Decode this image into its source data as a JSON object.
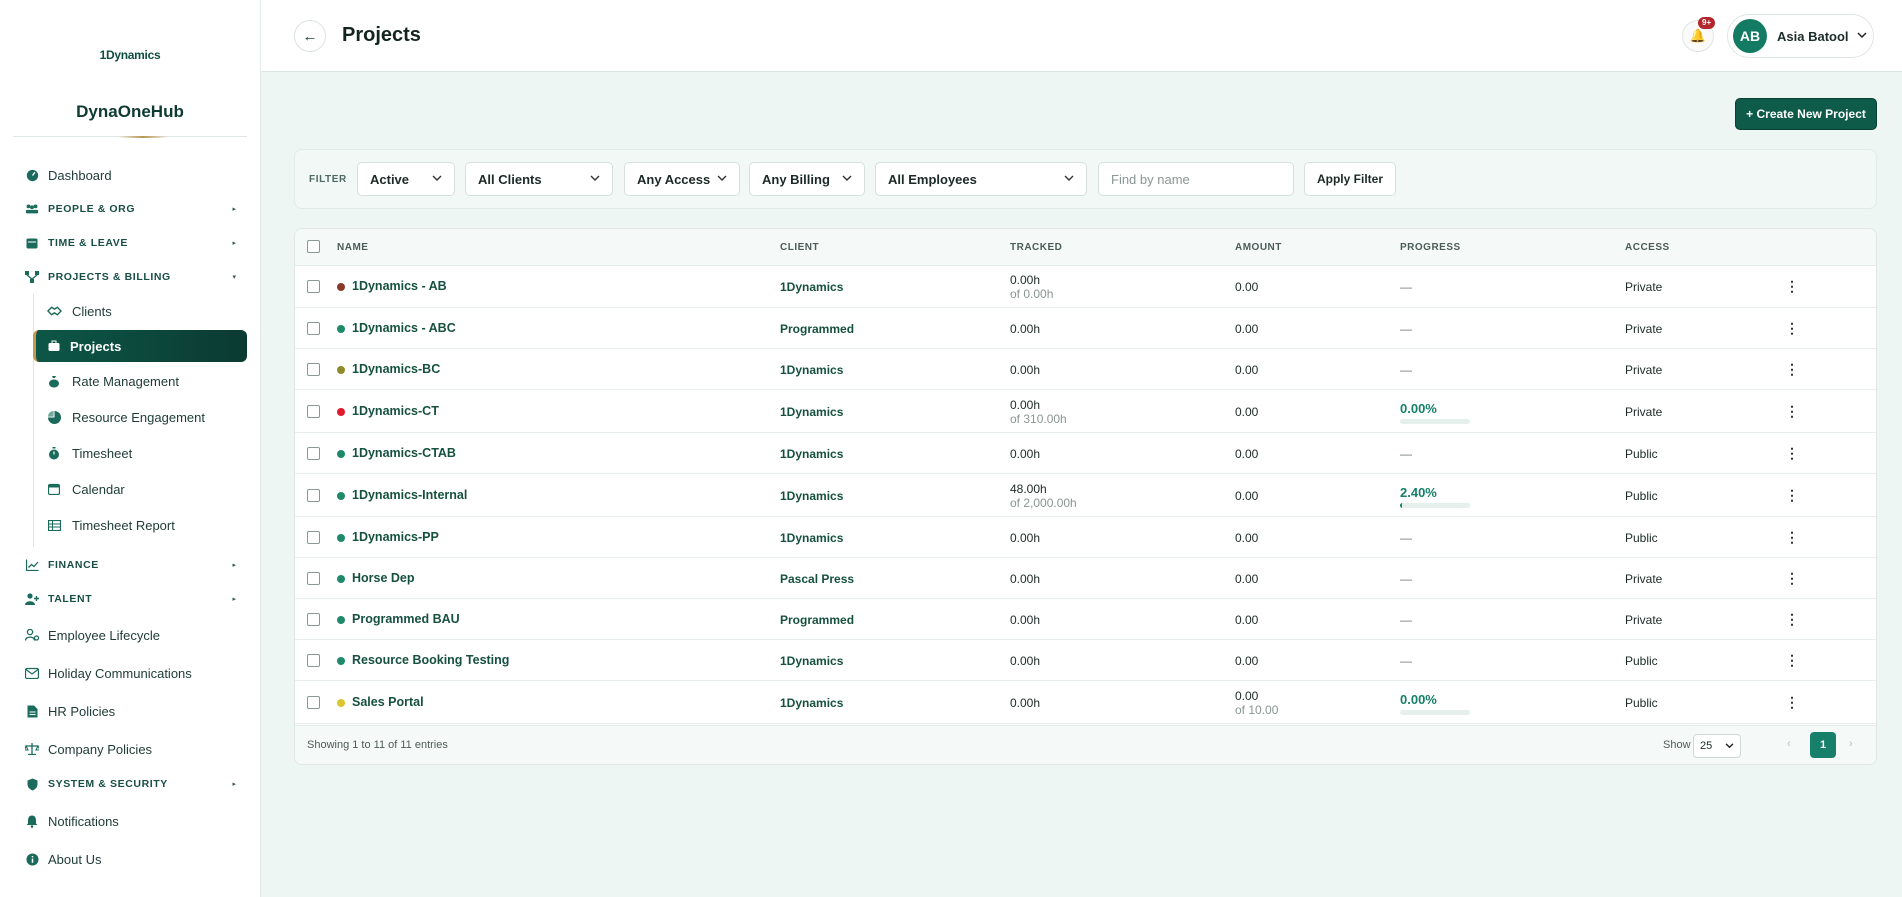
{
  "sidebar": {
    "logo": "1Dynamics",
    "brand": "DynaOneHub",
    "items": {
      "dashboard": "Dashboard",
      "people_org": "PEOPLE & ORG",
      "time_leave": "TIME & LEAVE",
      "projects_billing": "PROJECTS & BILLING",
      "clients": "Clients",
      "projects": "Projects",
      "rate_management": "Rate Management",
      "resource_engagement": "Resource Engagement",
      "timesheet": "Timesheet",
      "calendar": "Calendar",
      "timesheet_report": "Timesheet Report",
      "finance": "FINANCE",
      "talent": "TALENT",
      "employee_lifecycle": "Employee Lifecycle",
      "holiday_communications": "Holiday Communications",
      "hr_policies": "HR Policies",
      "company_policies": "Company Policies",
      "system_security": "SYSTEM & SECURITY",
      "notifications": "Notifications",
      "about_us": "About Us"
    }
  },
  "header": {
    "title": "Projects",
    "notification_badge": "9+",
    "user_initials": "AB",
    "user_name": "Asia Batool"
  },
  "actions": {
    "create_label": "+ Create New Project"
  },
  "filter": {
    "label": "FILTER",
    "status": "Active",
    "clients": "All Clients",
    "access": "Any Access",
    "billing": "Any Billing",
    "employees": "All Employees",
    "find_placeholder": "Find by name",
    "apply_label": "Apply Filter"
  },
  "table": {
    "columns": {
      "name": "NAME",
      "client": "CLIENT",
      "tracked": "TRACKED",
      "amount": "AMOUNT",
      "progress": "PROGRESS",
      "access": "ACCESS"
    },
    "rows": [
      {
        "name": "1Dynamics - AB",
        "dot": "#8b3a2a",
        "client": "1Dynamics",
        "tracked": "0.00h",
        "tracked_of": "of 0.00h",
        "amount": "0.00",
        "amount_of": "",
        "progress": "—",
        "progress_pct": null,
        "access": "Private",
        "menu": "⋮"
      },
      {
        "name": "1Dynamics - ABC",
        "dot": "#1f8a6a",
        "client": "Programmed",
        "tracked": "0.00h",
        "tracked_of": "",
        "amount": "0.00",
        "amount_of": "",
        "progress": "—",
        "progress_pct": null,
        "access": "Private",
        "menu": "⋮"
      },
      {
        "name": "1Dynamics-BC",
        "dot": "#8f8b2a",
        "client": "1Dynamics",
        "tracked": "0.00h",
        "tracked_of": "",
        "amount": "0.00",
        "amount_of": "",
        "progress": "—",
        "progress_pct": null,
        "access": "Private",
        "menu": "⋮"
      },
      {
        "name": "1Dynamics-CT",
        "dot": "#e0192b",
        "client": "1Dynamics",
        "tracked": "0.00h",
        "tracked_of": "of 310.00h",
        "amount": "0.00",
        "amount_of": "",
        "progress": "0.00%",
        "progress_pct": 0,
        "access": "Private",
        "menu": "⋮"
      },
      {
        "name": "1Dynamics-CTAB",
        "dot": "#1f8a6a",
        "client": "1Dynamics",
        "tracked": "0.00h",
        "tracked_of": "",
        "amount": "0.00",
        "amount_of": "",
        "progress": "—",
        "progress_pct": null,
        "access": "Public",
        "menu": "⋮"
      },
      {
        "name": "1Dynamics-Internal",
        "dot": "#1f8a6a",
        "client": "1Dynamics",
        "tracked": "48.00h",
        "tracked_of": "of 2,000.00h",
        "amount": "0.00",
        "amount_of": "",
        "progress": "2.40%",
        "progress_pct": 2.4,
        "access": "Public",
        "menu": "⋮"
      },
      {
        "name": "1Dynamics-PP",
        "dot": "#1f8a6a",
        "client": "1Dynamics",
        "tracked": "0.00h",
        "tracked_of": "",
        "amount": "0.00",
        "amount_of": "",
        "progress": "—",
        "progress_pct": null,
        "access": "Public",
        "menu": "⋮"
      },
      {
        "name": "Horse Dep",
        "dot": "#1f8a6a",
        "client": "Pascal Press",
        "tracked": "0.00h",
        "tracked_of": "",
        "amount": "0.00",
        "amount_of": "",
        "progress": "—",
        "progress_pct": null,
        "access": "Private",
        "menu": "⋮"
      },
      {
        "name": "Programmed BAU",
        "dot": "#1f8a6a",
        "client": "Programmed",
        "tracked": "0.00h",
        "tracked_of": "",
        "amount": "0.00",
        "amount_of": "",
        "progress": "—",
        "progress_pct": null,
        "access": "Private",
        "menu": "⋮"
      },
      {
        "name": "Resource Booking Testing",
        "dot": "#1f8a6a",
        "client": "1Dynamics",
        "tracked": "0.00h",
        "tracked_of": "",
        "amount": "0.00",
        "amount_of": "",
        "progress": "—",
        "progress_pct": null,
        "access": "Public",
        "menu": "⋮"
      },
      {
        "name": "Sales Portal",
        "dot": "#d9c630",
        "client": "1Dynamics",
        "tracked": "0.00h",
        "tracked_of": "",
        "amount": "0.00",
        "amount_of": "of 10.00",
        "progress": "0.00%",
        "progress_pct": 0,
        "access": "Public",
        "menu": "⋮"
      }
    ]
  },
  "footer": {
    "showing": "Showing 1 to 11 of 11 entries",
    "show_label": "Show",
    "page_size": "25",
    "current_page": "1",
    "prev": "‹",
    "next": "›"
  }
}
